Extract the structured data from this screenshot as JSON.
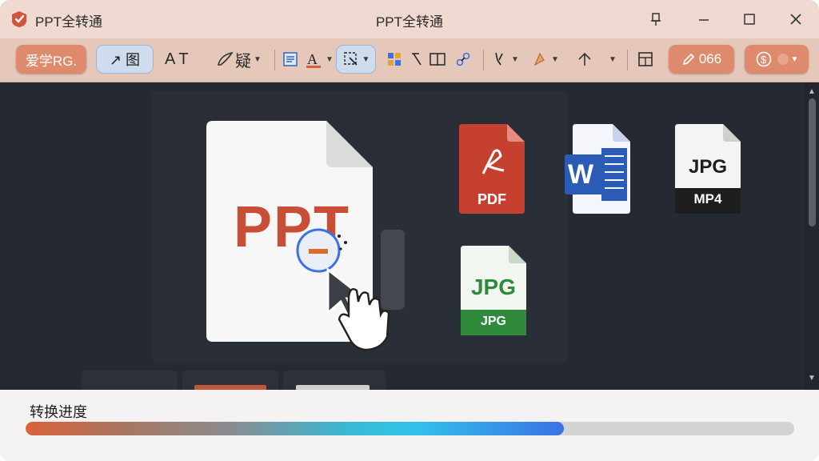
{
  "window": {
    "app_title": "PPT全转通",
    "center_title": "PPT全转通",
    "controls": [
      "pin-icon",
      "minimize-icon",
      "maximize-icon",
      "close-icon"
    ]
  },
  "toolbar": {
    "primary_button": "爱学RG.",
    "select_tool": "↗ 图",
    "text_tool": "A T",
    "shape_tool": "疑",
    "count_button": "066",
    "colors": {
      "accent_orange": "#de8a6c",
      "active_blue": "#cfdcee",
      "toolbar_bg": "#e6c8bb"
    }
  },
  "canvas": {
    "main_document_label": "PPT",
    "files": [
      {
        "kind": "pdf",
        "label": "PDF",
        "color": "#c6402f"
      },
      {
        "kind": "word",
        "label": "W",
        "color": "#2a5bb6"
      },
      {
        "kind": "jpg-mp4",
        "label_top": "JPG",
        "label_bottom": "MP4",
        "color": "#1e1e1e"
      },
      {
        "kind": "jpg",
        "label_top": "JPG",
        "label_bottom": "JPG",
        "color": "#2f8a3c"
      }
    ]
  },
  "progress": {
    "label": "转换进度",
    "value_percent": 70
  }
}
